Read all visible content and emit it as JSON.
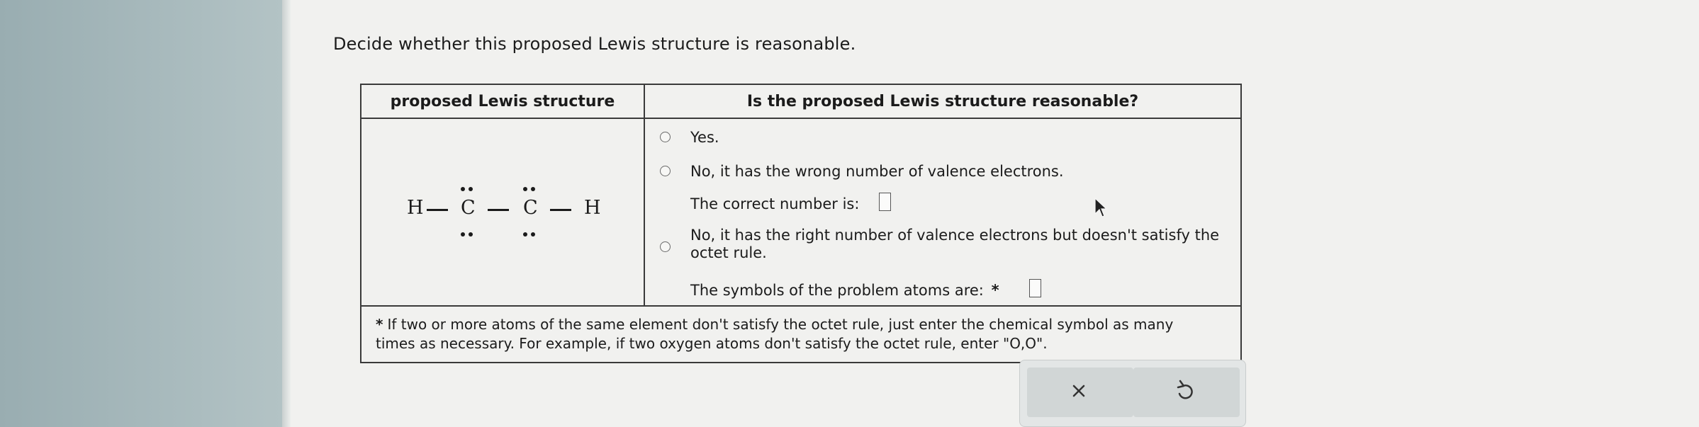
{
  "question": {
    "prompt": "Decide whether this proposed Lewis structure is reasonable."
  },
  "table": {
    "col1_header": "proposed Lewis structure",
    "col2_header": "Is the proposed Lewis structure reasonable?"
  },
  "structure": {
    "atoms": [
      "H",
      "C",
      "C",
      "H"
    ],
    "lone_pairs_per_carbon": 2
  },
  "options": {
    "yes": "Yes.",
    "no_valence": "No, it has the wrong number of valence electrons.",
    "correct_number_label": "The correct number is:",
    "correct_number_value": "",
    "no_octet_line1": "No, it has the right number of valence electrons but doesn't satisfy the",
    "no_octet_line2": "octet rule.",
    "problem_atoms_label": "The symbols of the problem atoms are:",
    "problem_atoms_marker": "*",
    "problem_atoms_value": ""
  },
  "footnote": {
    "marker": "*",
    "line1": "If two or more atoms of the same element don't satisfy the octet rule, just enter the chemical symbol as many",
    "line2": "times as necessary. For example, if two oxygen atoms don't satisfy the octet rule, enter \"O,O\"."
  },
  "actions": {
    "clear_icon": "x-icon",
    "undo_icon": "undo-icon"
  }
}
